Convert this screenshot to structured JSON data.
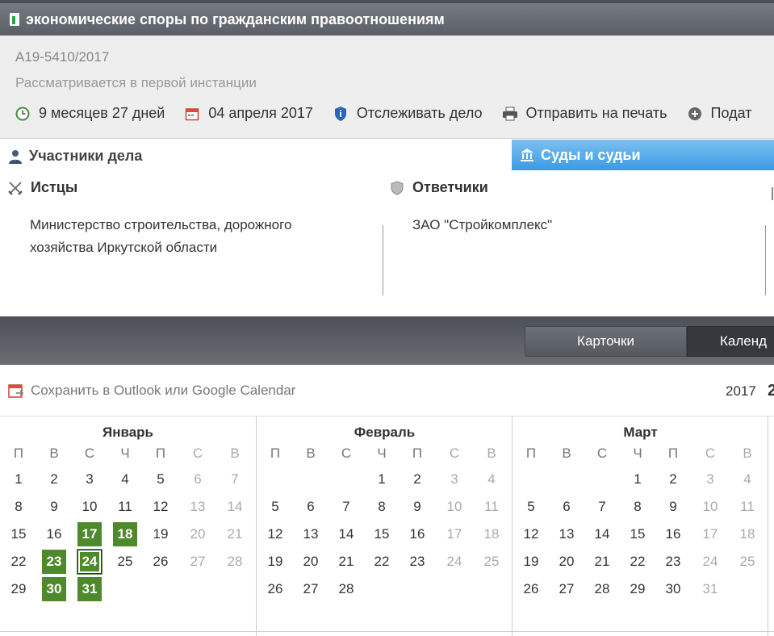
{
  "title": "экономические споры по гражданским правоотношениям",
  "case": {
    "number": "А19-5410/2017",
    "status": "Рассматривается в первой инстанции"
  },
  "actions": [
    {
      "label": "9 месяцев 27 дней",
      "icon": "clock-icon"
    },
    {
      "label": "04 апреля 2017",
      "icon": "calendar-icon"
    },
    {
      "label": "Отслеживать дело",
      "icon": "shield-info-icon"
    },
    {
      "label": "Отправить на печать",
      "icon": "printer-icon"
    },
    {
      "label": "Подат",
      "icon": "plus-circle-icon"
    }
  ],
  "tabs": {
    "participants": "Участники дела",
    "courts": "Суды и судьи"
  },
  "parties": {
    "plaintiffs_title": "Истцы",
    "plaintiffs_value_line1": "Министерство строительства, дорожного",
    "plaintiffs_value_line2": "хозяйства Иркутской области",
    "defendants_title": "Ответчики",
    "defendants_value": "ЗАО \"Стройкомплекс\""
  },
  "view_buttons": {
    "cards": "Карточки",
    "calendar": "Календ"
  },
  "outlook_link": "Сохранить в Outlook или Google Calendar",
  "year": "2017",
  "year_next_partial": "2",
  "colors": {
    "accent_blue": "#3a9be3",
    "event_green": "#4e8a2b",
    "titlebar": "#5a5e66"
  },
  "calendar": {
    "weekdays": [
      "П",
      "В",
      "С",
      "Ч",
      "П",
      "С",
      "В"
    ],
    "months": [
      {
        "name": "Январь",
        "weeks": [
          [
            "",
            "",
            "",
            "",
            "",
            "",
            ""
          ],
          [
            "1",
            "2",
            "3",
            "4",
            "5",
            "6",
            "7"
          ],
          [
            "8",
            "9",
            "10",
            "11",
            "12",
            "13",
            "14"
          ],
          [
            "15",
            "16",
            "17",
            "18",
            "19",
            "20",
            "21"
          ],
          [
            "22",
            "23",
            "24",
            "25",
            "26",
            "27",
            "28"
          ],
          [
            "29",
            "30",
            "31",
            "",
            "",
            "",
            ""
          ]
        ],
        "events": [
          "17",
          "18",
          "23",
          "24",
          "30",
          "31"
        ],
        "today": "24"
      },
      {
        "name": "Февраль",
        "weeks": [
          [
            "",
            "",
            "",
            "1",
            "2",
            "3",
            "4"
          ],
          [
            "5",
            "6",
            "7",
            "8",
            "9",
            "10",
            "11"
          ],
          [
            "12",
            "13",
            "14",
            "15",
            "16",
            "17",
            "18"
          ],
          [
            "19",
            "20",
            "21",
            "22",
            "23",
            "24",
            "25"
          ],
          [
            "26",
            "27",
            "28",
            "",
            "",
            "",
            ""
          ]
        ],
        "events": [],
        "today": ""
      },
      {
        "name": "Март",
        "weeks": [
          [
            "",
            "",
            "",
            "1",
            "2",
            "3",
            "4"
          ],
          [
            "5",
            "6",
            "7",
            "8",
            "9",
            "10",
            "11"
          ],
          [
            "12",
            "13",
            "14",
            "15",
            "16",
            "17",
            "18"
          ],
          [
            "19",
            "20",
            "21",
            "22",
            "23",
            "24",
            "25"
          ],
          [
            "26",
            "27",
            "28",
            "29",
            "30",
            "31",
            ""
          ]
        ],
        "events": [],
        "today": ""
      }
    ]
  }
}
